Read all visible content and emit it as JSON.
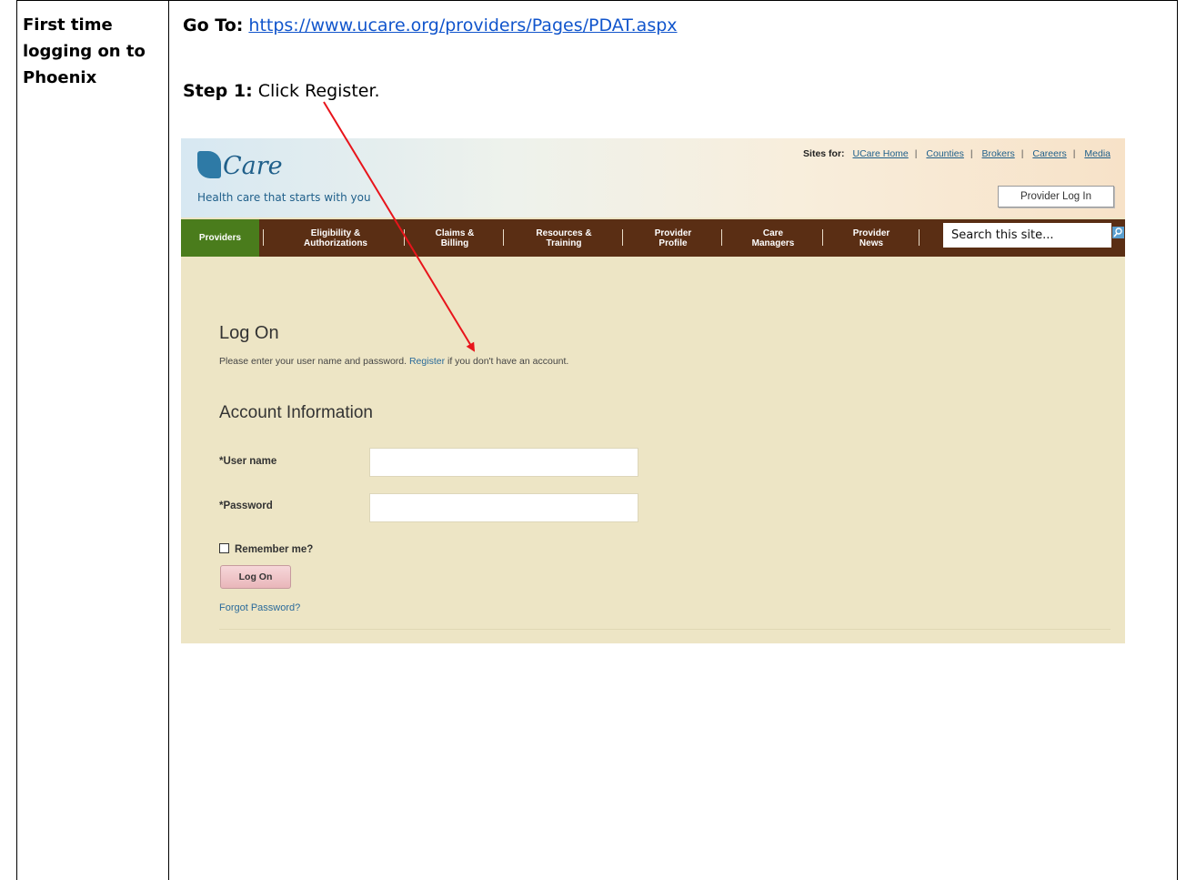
{
  "left_label": "First time logging on to Phoenix",
  "goto": {
    "label": "Go To:",
    "url": "https://www.ucare.org/providers/Pages/PDAT.aspx"
  },
  "step1": {
    "label": "Step 1:",
    "text": "Click Register."
  },
  "site": {
    "logo": "Care",
    "tagline": "Health care that starts with you",
    "sites_for_label": "Sites for:",
    "sites_links": [
      "UCare Home",
      "Counties",
      "Brokers",
      "Careers",
      "Media"
    ],
    "provider_login": "Provider Log In",
    "nav": [
      {
        "line1": "Providers",
        "line2": ""
      },
      {
        "line1": "Eligibility &",
        "line2": "Authorizations"
      },
      {
        "line1": "Claims &",
        "line2": "Billing"
      },
      {
        "line1": "Resources &",
        "line2": "Training"
      },
      {
        "line1": "Provider",
        "line2": "Profile"
      },
      {
        "line1": "Care",
        "line2": "Managers"
      },
      {
        "line1": "Provider",
        "line2": "News"
      }
    ],
    "search_value": "Search this site...",
    "logon_title": "Log On",
    "logon_desc_before": "Please enter your user name and password.",
    "register_link": "Register",
    "logon_desc_after": "if you don't have an account.",
    "account_title": "Account Information",
    "username_label": "*User name",
    "password_label": "*Password",
    "remember_label": "Remember me?",
    "logon_button": "Log On",
    "forgot_link": "Forgot Password?"
  },
  "colors": {
    "link": "#1155cc",
    "nav_bg": "#5a2e14",
    "nav_active": "#4a7c1c",
    "page_bg": "#ede5c5",
    "arrow": "#e8141b"
  }
}
